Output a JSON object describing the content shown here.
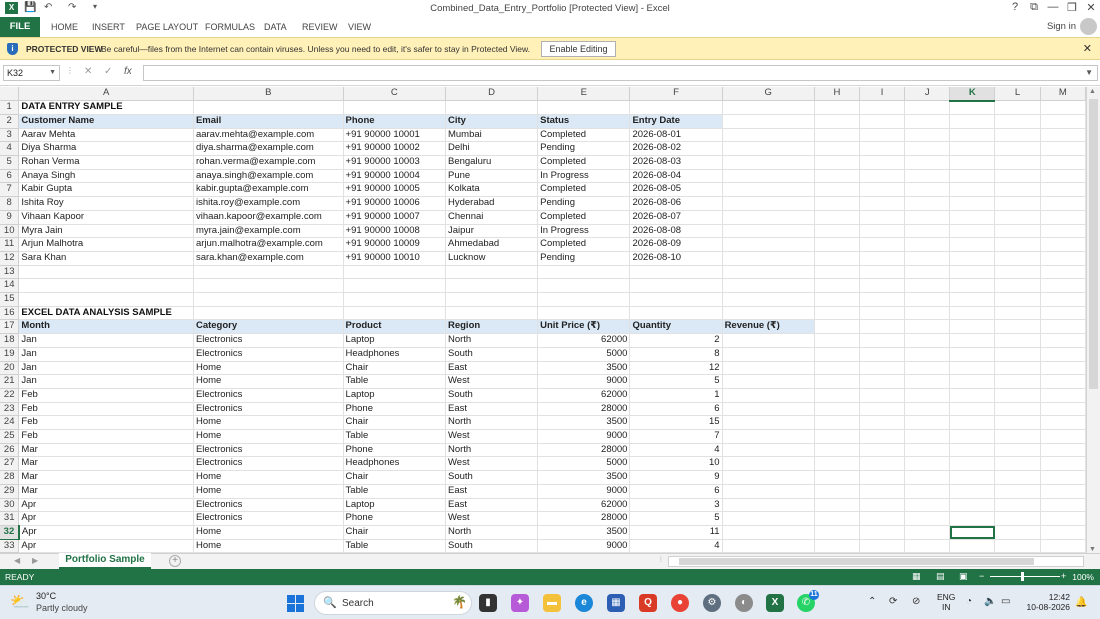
{
  "window": {
    "title": "Combined_Data_Entry_Portfolio  [Protected View] - Excel",
    "controls": [
      "?",
      "⧉",
      "—",
      "❐",
      "✕"
    ]
  },
  "ribbon": {
    "file": "FILE",
    "tabs": [
      "HOME",
      "INSERT",
      "PAGE LAYOUT",
      "FORMULAS",
      "DATA",
      "REVIEW",
      "VIEW"
    ],
    "signin": "Sign in"
  },
  "protected_view": {
    "label": "PROTECTED VIEW",
    "message": "Be careful—files from the Internet can contain viruses. Unless you need to edit, it's safer to stay in Protected View.",
    "button": "Enable Editing",
    "close": "✕"
  },
  "formula_bar": {
    "name_box": "K32",
    "cancel": "✕",
    "enter": "✓",
    "fx": "fx",
    "value": ""
  },
  "grid": {
    "columns": [
      "A",
      "B",
      "C",
      "D",
      "E",
      "F",
      "G",
      "H",
      "I",
      "J",
      "K",
      "L",
      "M"
    ],
    "active_column": "K",
    "active_row": "32",
    "rows": [
      [
        "1",
        "DATA ENTRY SAMPLE",
        "",
        "",
        "",
        "",
        "",
        "",
        "",
        "",
        "",
        "",
        "",
        ""
      ],
      [
        "2",
        "Customer Name",
        "Email",
        "Phone",
        "City",
        "Status",
        "Entry Date",
        "",
        "",
        "",
        "",
        "",
        "",
        ""
      ],
      [
        "3",
        "Aarav Mehta",
        "aarav.mehta@example.com",
        "+91 90000 10001",
        "Mumbai",
        "Completed",
        "2026-08-01",
        "",
        "",
        "",
        "",
        "",
        "",
        ""
      ],
      [
        "4",
        "Diya Sharma",
        "diya.sharma@example.com",
        "+91 90000 10002",
        "Delhi",
        "Pending",
        "2026-08-02",
        "",
        "",
        "",
        "",
        "",
        "",
        ""
      ],
      [
        "5",
        "Rohan Verma",
        "rohan.verma@example.com",
        "+91 90000 10003",
        "Bengaluru",
        "Completed",
        "2026-08-03",
        "",
        "",
        "",
        "",
        "",
        "",
        ""
      ],
      [
        "6",
        "Anaya Singh",
        "anaya.singh@example.com",
        "+91 90000 10004",
        "Pune",
        "In Progress",
        "2026-08-04",
        "",
        "",
        "",
        "",
        "",
        "",
        ""
      ],
      [
        "7",
        "Kabir Gupta",
        "kabir.gupta@example.com",
        "+91 90000 10005",
        "Kolkata",
        "Completed",
        "2026-08-05",
        "",
        "",
        "",
        "",
        "",
        "",
        ""
      ],
      [
        "8",
        "Ishita Roy",
        "ishita.roy@example.com",
        "+91 90000 10006",
        "Hyderabad",
        "Pending",
        "2026-08-06",
        "",
        "",
        "",
        "",
        "",
        "",
        ""
      ],
      [
        "9",
        "Vihaan Kapoor",
        "vihaan.kapoor@example.com",
        "+91 90000 10007",
        "Chennai",
        "Completed",
        "2026-08-07",
        "",
        "",
        "",
        "",
        "",
        "",
        ""
      ],
      [
        "10",
        "Myra Jain",
        "myra.jain@example.com",
        "+91 90000 10008",
        "Jaipur",
        "In Progress",
        "2026-08-08",
        "",
        "",
        "",
        "",
        "",
        "",
        ""
      ],
      [
        "11",
        "Arjun Malhotra",
        "arjun.malhotra@example.com",
        "+91 90000 10009",
        "Ahmedabad",
        "Completed",
        "2026-08-09",
        "",
        "",
        "",
        "",
        "",
        "",
        ""
      ],
      [
        "12",
        "Sara Khan",
        "sara.khan@example.com",
        "+91 90000 10010",
        "Lucknow",
        "Pending",
        "2026-08-10",
        "",
        "",
        "",
        "",
        "",
        "",
        ""
      ],
      [
        "13",
        "",
        "",
        "",
        "",
        "",
        "",
        "",
        "",
        "",
        "",
        "",
        "",
        ""
      ],
      [
        "14",
        "",
        "",
        "",
        "",
        "",
        "",
        "",
        "",
        "",
        "",
        "",
        "",
        ""
      ],
      [
        "15",
        "",
        "",
        "",
        "",
        "",
        "",
        "",
        "",
        "",
        "",
        "",
        "",
        ""
      ],
      [
        "16",
        "EXCEL DATA ANALYSIS SAMPLE",
        "",
        "",
        "",
        "",
        "",
        "",
        "",
        "",
        "",
        "",
        "",
        ""
      ],
      [
        "17",
        "Month",
        "Category",
        "Product",
        "Region",
        "Unit Price (₹)",
        "Quantity",
        "Revenue (₹)",
        "",
        "",
        "",
        "",
        "",
        ""
      ],
      [
        "18",
        "Jan",
        "Electronics",
        "Laptop",
        "North",
        "62000",
        "2",
        "",
        "",
        "",
        "",
        "",
        "",
        ""
      ],
      [
        "19",
        "Jan",
        "Electronics",
        "Headphones",
        "South",
        "5000",
        "8",
        "",
        "",
        "",
        "",
        "",
        "",
        ""
      ],
      [
        "20",
        "Jan",
        "Home",
        "Chair",
        "East",
        "3500",
        "12",
        "",
        "",
        "",
        "",
        "",
        "",
        ""
      ],
      [
        "21",
        "Jan",
        "Home",
        "Table",
        "West",
        "9000",
        "5",
        "",
        "",
        "",
        "",
        "",
        "",
        ""
      ],
      [
        "22",
        "Feb",
        "Electronics",
        "Laptop",
        "South",
        "62000",
        "1",
        "",
        "",
        "",
        "",
        "",
        "",
        ""
      ],
      [
        "23",
        "Feb",
        "Electronics",
        "Phone",
        "East",
        "28000",
        "6",
        "",
        "",
        "",
        "",
        "",
        "",
        ""
      ],
      [
        "24",
        "Feb",
        "Home",
        "Chair",
        "North",
        "3500",
        "15",
        "",
        "",
        "",
        "",
        "",
        "",
        ""
      ],
      [
        "25",
        "Feb",
        "Home",
        "Table",
        "West",
        "9000",
        "7",
        "",
        "",
        "",
        "",
        "",
        "",
        ""
      ],
      [
        "26",
        "Mar",
        "Electronics",
        "Phone",
        "North",
        "28000",
        "4",
        "",
        "",
        "",
        "",
        "",
        "",
        ""
      ],
      [
        "27",
        "Mar",
        "Electronics",
        "Headphones",
        "West",
        "5000",
        "10",
        "",
        "",
        "",
        "",
        "",
        "",
        ""
      ],
      [
        "28",
        "Mar",
        "Home",
        "Chair",
        "South",
        "3500",
        "9",
        "",
        "",
        "",
        "",
        "",
        "",
        ""
      ],
      [
        "29",
        "Mar",
        "Home",
        "Table",
        "East",
        "9000",
        "6",
        "",
        "",
        "",
        "",
        "",
        "",
        ""
      ],
      [
        "30",
        "Apr",
        "Electronics",
        "Laptop",
        "East",
        "62000",
        "3",
        "",
        "",
        "",
        "",
        "",
        "",
        ""
      ],
      [
        "31",
        "Apr",
        "Electronics",
        "Phone",
        "West",
        "28000",
        "5",
        "",
        "",
        "",
        "",
        "",
        "",
        ""
      ],
      [
        "32",
        "Apr",
        "Home",
        "Chair",
        "North",
        "3500",
        "11",
        "",
        "",
        "",
        "",
        "",
        "",
        ""
      ],
      [
        "33",
        "Apr",
        "Home",
        "Table",
        "South",
        "9000",
        "4",
        "",
        "",
        "",
        "",
        "",
        "",
        ""
      ]
    ]
  },
  "sheets": {
    "tabs": [
      "Portfolio Sample"
    ],
    "add": "+"
  },
  "status_bar": {
    "state": "READY",
    "zoom": "100%"
  },
  "taskbar": {
    "weather_temp": "30°C",
    "weather_desc": "Partly cloudy",
    "search_placeholder": "Search",
    "whatsapp_badge": "11",
    "lang_1": "ENG",
    "lang_2": "IN",
    "time": "12:42",
    "date": "10-08-2026"
  },
  "colors": {
    "excel_green": "#217346",
    "header_fill": "#dbe9f7",
    "protected_bar": "#fff1b8"
  }
}
